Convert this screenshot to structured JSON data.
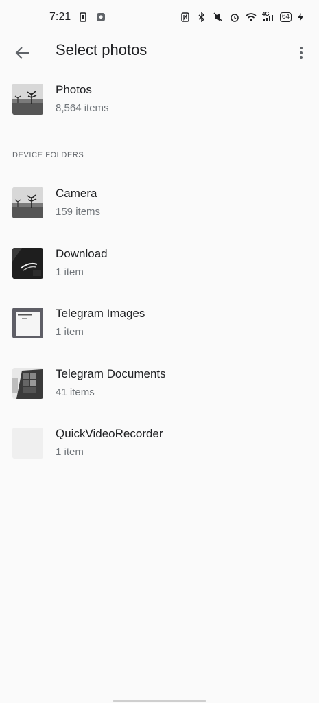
{
  "status_bar": {
    "time": "7:21",
    "battery": "64",
    "left_icons": [
      "screenshot-icon",
      "app-notification-icon"
    ],
    "right_icons": [
      "nfc-icon",
      "bluetooth-icon",
      "mute-icon",
      "alarm-icon",
      "wifi-icon",
      "signal-4g-icon",
      "battery-icon",
      "charging-icon"
    ],
    "signal_label": "4G"
  },
  "app_bar": {
    "title": "Select photos",
    "back_icon": "arrow-back-icon",
    "menu_icon": "more-vert-icon"
  },
  "top_album": {
    "title": "Photos",
    "count": "8,564 items"
  },
  "section_header": "DEVICE FOLDERS",
  "folders": [
    {
      "title": "Camera",
      "count": "159 items"
    },
    {
      "title": "Download",
      "count": "1 item"
    },
    {
      "title": "Telegram Images",
      "count": "1 item"
    },
    {
      "title": "Telegram Documents",
      "count": "41 items"
    },
    {
      "title": "QuickVideoRecorder",
      "count": "1 item"
    }
  ],
  "colors": {
    "background": "#fafafa",
    "primary_text": "#202124",
    "secondary_text": "#70757a"
  }
}
